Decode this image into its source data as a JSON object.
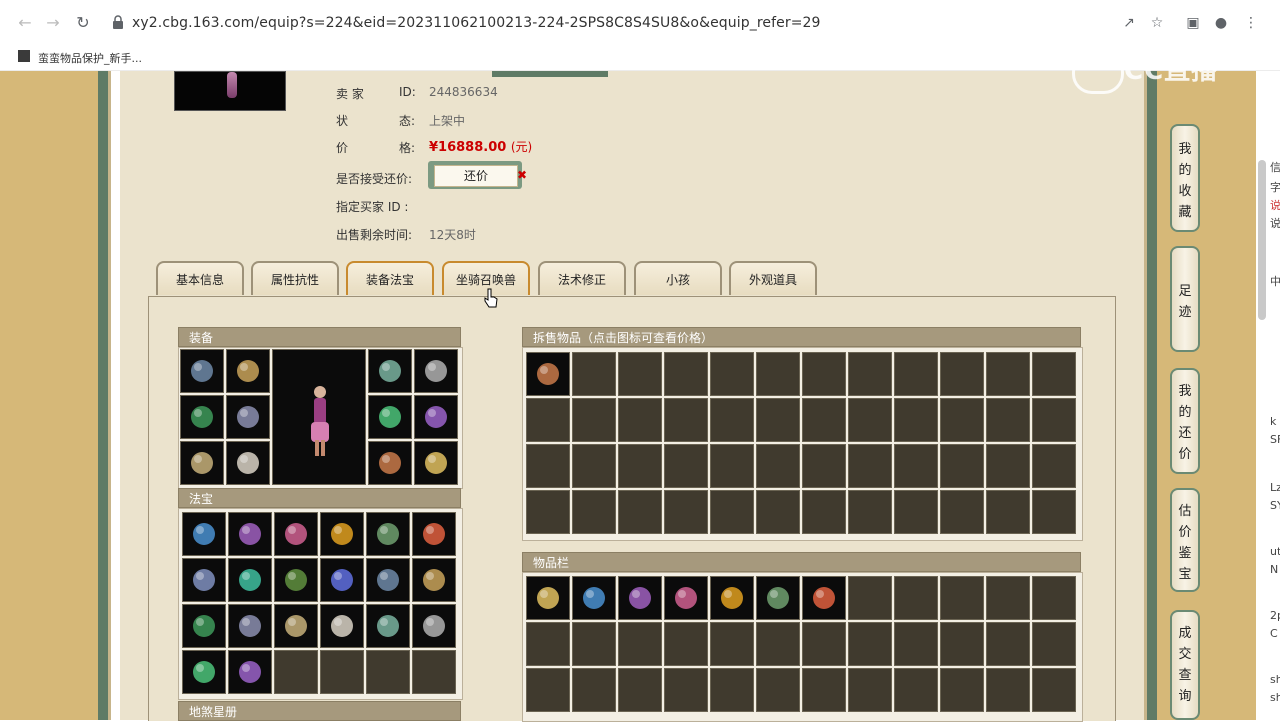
{
  "browser": {
    "url": "xy2.cbg.163.com/equip?s=224&eid=202311062100213-224-2SPS8C8S4SU8&o&equip_refer=29",
    "bookmark_label": "蛮蛮物品保护_新手..."
  },
  "watermark": "CC直播",
  "seller_info": {
    "seller_label": "卖 家",
    "seller_id_label": "ID:",
    "seller_id": "244836634",
    "status_label_1": "状",
    "status_label_2": "态:",
    "status_value": "上架中",
    "price_label_1": "价",
    "price_label_2": "格:",
    "price_value": "¥16888.00",
    "price_unit": "(元)",
    "counter_label": "是否接受还价:",
    "counter_button": "还价",
    "buyer_label": "指定买家 ID :",
    "remaining_label": "出售剩余时间:",
    "remaining_value": "12天8时"
  },
  "tabs": [
    "基本信息",
    "属性抗性",
    "装备法宝",
    "坐骑召唤兽",
    "法术修正",
    "小孩",
    "外观道具"
  ],
  "sections": {
    "equipment": "装备",
    "magic_treasure": "法宝",
    "star_book": "地煞星册",
    "sale_items": "拆售物品（点击图标可查看价格）",
    "inventory": "物品栏"
  },
  "equipment_slots": [
    "cape",
    "wings-ornament",
    "sword",
    "robe",
    "boots-jade",
    "mask",
    "necklace",
    "bracelet",
    "bracelet",
    "ring",
    "orb"
  ],
  "sidebar": [
    {
      "chars": [
        "我",
        "的",
        "收",
        "藏"
      ]
    },
    {
      "chars": [
        "足",
        "迹"
      ]
    },
    {
      "chars": [
        "我",
        "的",
        "还",
        "价"
      ]
    },
    {
      "chars": [
        "估",
        "价",
        "鉴",
        "宝"
      ]
    },
    {
      "chars": [
        "成",
        "交",
        "查",
        "询"
      ]
    }
  ],
  "right_sliver_text": [
    "信",
    "字",
    "说",
    "说",
    "中",
    "k",
    "SF",
    "Lz",
    "SY",
    "ut",
    "N",
    "2p",
    "C",
    "sh",
    "sh"
  ],
  "colors": {
    "accent_green": "#5f7b66",
    "price_red": "#cc0000",
    "header_tan": "#a6997d",
    "cell_dark": "#403a2e"
  }
}
